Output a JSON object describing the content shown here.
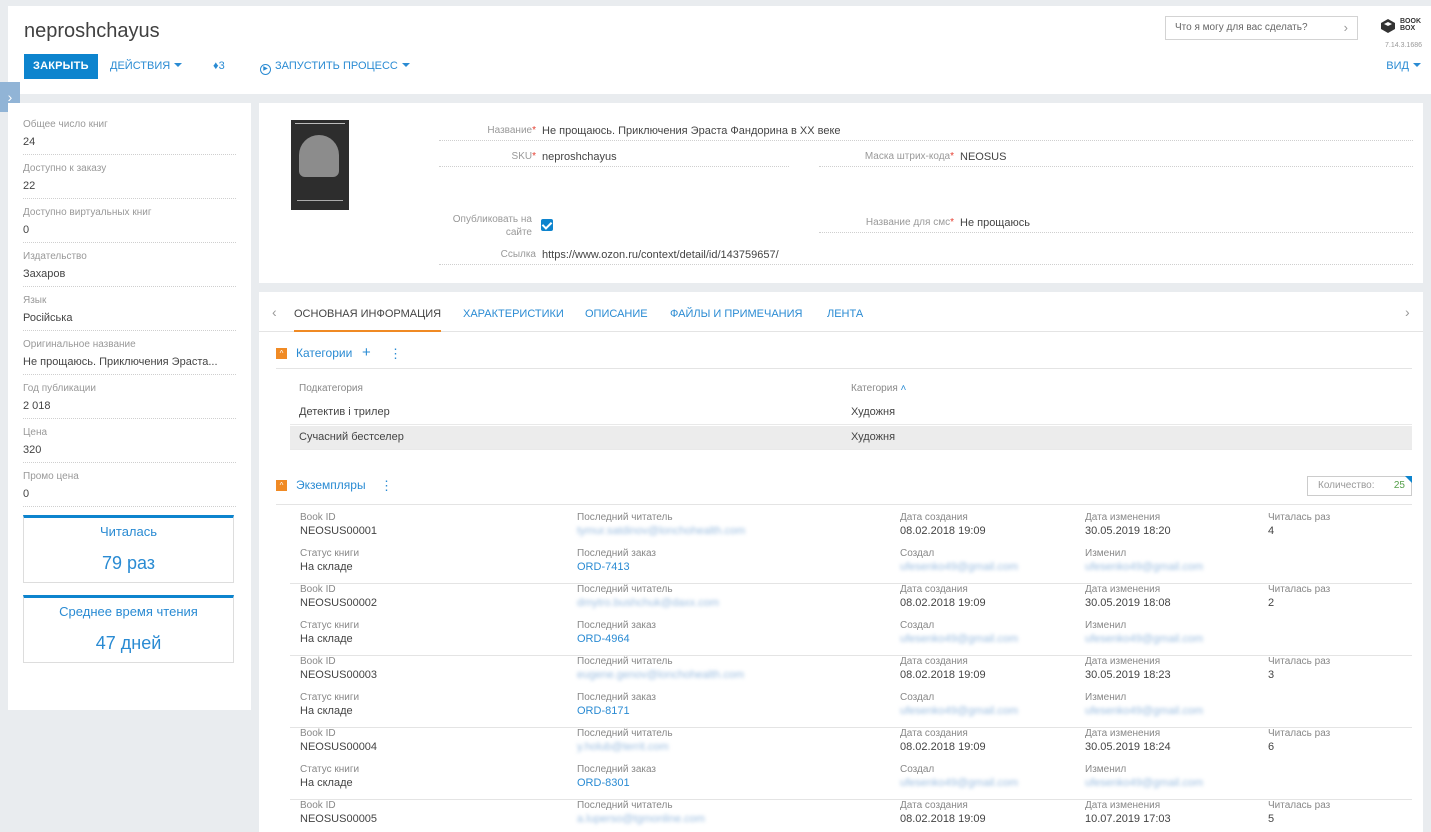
{
  "header": {
    "title": "neproshchayus",
    "close_label": "ЗАКРЫТЬ",
    "actions_label": "ДЕЙСТВИЯ",
    "tags_count": "3",
    "run_process_label": "ЗАПУСТИТЬ ПРОЦЕСС",
    "search_placeholder": "Что я могу для вас сделать?",
    "logo_line1": "BOOK",
    "logo_line2": "BOX",
    "version": "7.14.3.1686",
    "view_label": "ВИД"
  },
  "left_panel": {
    "fields": [
      {
        "label": "Общее число книг",
        "value": "24"
      },
      {
        "label": "Доступно к заказу",
        "value": "22"
      },
      {
        "label": "Доступно виртуальных книг",
        "value": "0"
      },
      {
        "label": "Издательство",
        "value": "Захаров"
      },
      {
        "label": "Язык",
        "value": "Російська"
      },
      {
        "label": "Оригинальное название",
        "value": "Не прощаюсь. Приключения Эраста..."
      },
      {
        "label": "Год публикации",
        "value": "2 018"
      },
      {
        "label": "Цена",
        "value": "320"
      },
      {
        "label": "Промо цена",
        "value": "0"
      }
    ],
    "widgets": [
      {
        "title": "Читалась",
        "value": "79 раз"
      },
      {
        "title": "Среднее время чтения",
        "value": "47 дней"
      }
    ]
  },
  "card": {
    "name_label": "Название",
    "name_value": "Не прощаюсь. Приключения Эраста Фандорина в XX веке",
    "sku_label": "SKU",
    "sku_value": "neproshchayus",
    "barcode_label": "Маска штрих-кода",
    "barcode_value": "NEOSUS",
    "publish_label_1": "Опубликовать на",
    "publish_label_2": "сайте",
    "publish_checked": true,
    "sms_label": "Название для смс",
    "sms_value": "Не прощаюсь",
    "link_label": "Ссылка",
    "link_value": "https://www.ozon.ru/context/detail/id/143759657/",
    "cover_top": "ПОДАЮ АКУНИНА",
    "cover_author": "Борис Акунин",
    "cover_title": "НЕ ПРОЩАЮСЬ"
  },
  "tabs": [
    "ОСНОВНАЯ ИНФОРМАЦИЯ",
    "ХАРАКТЕРИСТИКИ",
    "ОПИСАНИЕ",
    "ФАЙЛЫ И ПРИМЕЧАНИЯ",
    "ЛЕНТА"
  ],
  "categories": {
    "title": "Категории",
    "col_sub": "Подкатегория",
    "col_cat": "Категория",
    "rows": [
      {
        "sub": "Детектив і трилер",
        "cat": "Художня"
      },
      {
        "sub": "Сучасний бестселер",
        "cat": "Художня"
      }
    ]
  },
  "copies": {
    "title": "Экземпляры",
    "qty_label": "Количество:",
    "qty_value": "25",
    "labels": {
      "book_id": "Book ID",
      "status": "Статус книги",
      "last_reader": "Последний читатель",
      "last_order": "Последний заказ",
      "created_at": "Дата создания",
      "created_by": "Создал",
      "modified_at": "Дата изменения",
      "modified_by": "Изменил",
      "read_count": "Читалась раз"
    },
    "records": [
      {
        "id": "NEOSUS00001",
        "status": "На складе",
        "reader": "tymur.satdinov@lonchohealth.com",
        "order": "ORD-7413",
        "created": "08.02.2018 19:09",
        "creator": "ufesenko49@gmail.com",
        "modified": "30.05.2019 18:20",
        "modifier": "ufesenko49@gmail.com",
        "count": "4"
      },
      {
        "id": "NEOSUS00002",
        "status": "На складе",
        "reader": "dmytro.bushchuk@daxx.com",
        "order": "ORD-4964",
        "created": "08.02.2018 19:09",
        "creator": "ufesenko49@gmail.com",
        "modified": "30.05.2019 18:08",
        "modifier": "ufesenko49@gmail.com",
        "count": "2"
      },
      {
        "id": "NEOSUS00003",
        "status": "На складе",
        "reader": "eugene.genov@lonchohealth.com",
        "order": "ORD-8171",
        "created": "08.02.2018 19:09",
        "creator": "ufesenko49@gmail.com",
        "modified": "30.05.2019 18:23",
        "modifier": "ufesenko49@gmail.com",
        "count": "3"
      },
      {
        "id": "NEOSUS00004",
        "status": "На складе",
        "reader": "y.holub@territ.com",
        "order": "ORD-8301",
        "created": "08.02.2018 19:09",
        "creator": "ufesenko49@gmail.com",
        "modified": "30.05.2019 18:24",
        "modifier": "ufesenko49@gmail.com",
        "count": "6"
      },
      {
        "id": "NEOSUS00005",
        "status": "",
        "reader": "a.luperso@tgmonline.com",
        "order": "",
        "created": "08.02.2018 19:09",
        "creator": "",
        "modified": "10.07.2019 17:03",
        "modifier": "",
        "count": "5"
      }
    ]
  }
}
